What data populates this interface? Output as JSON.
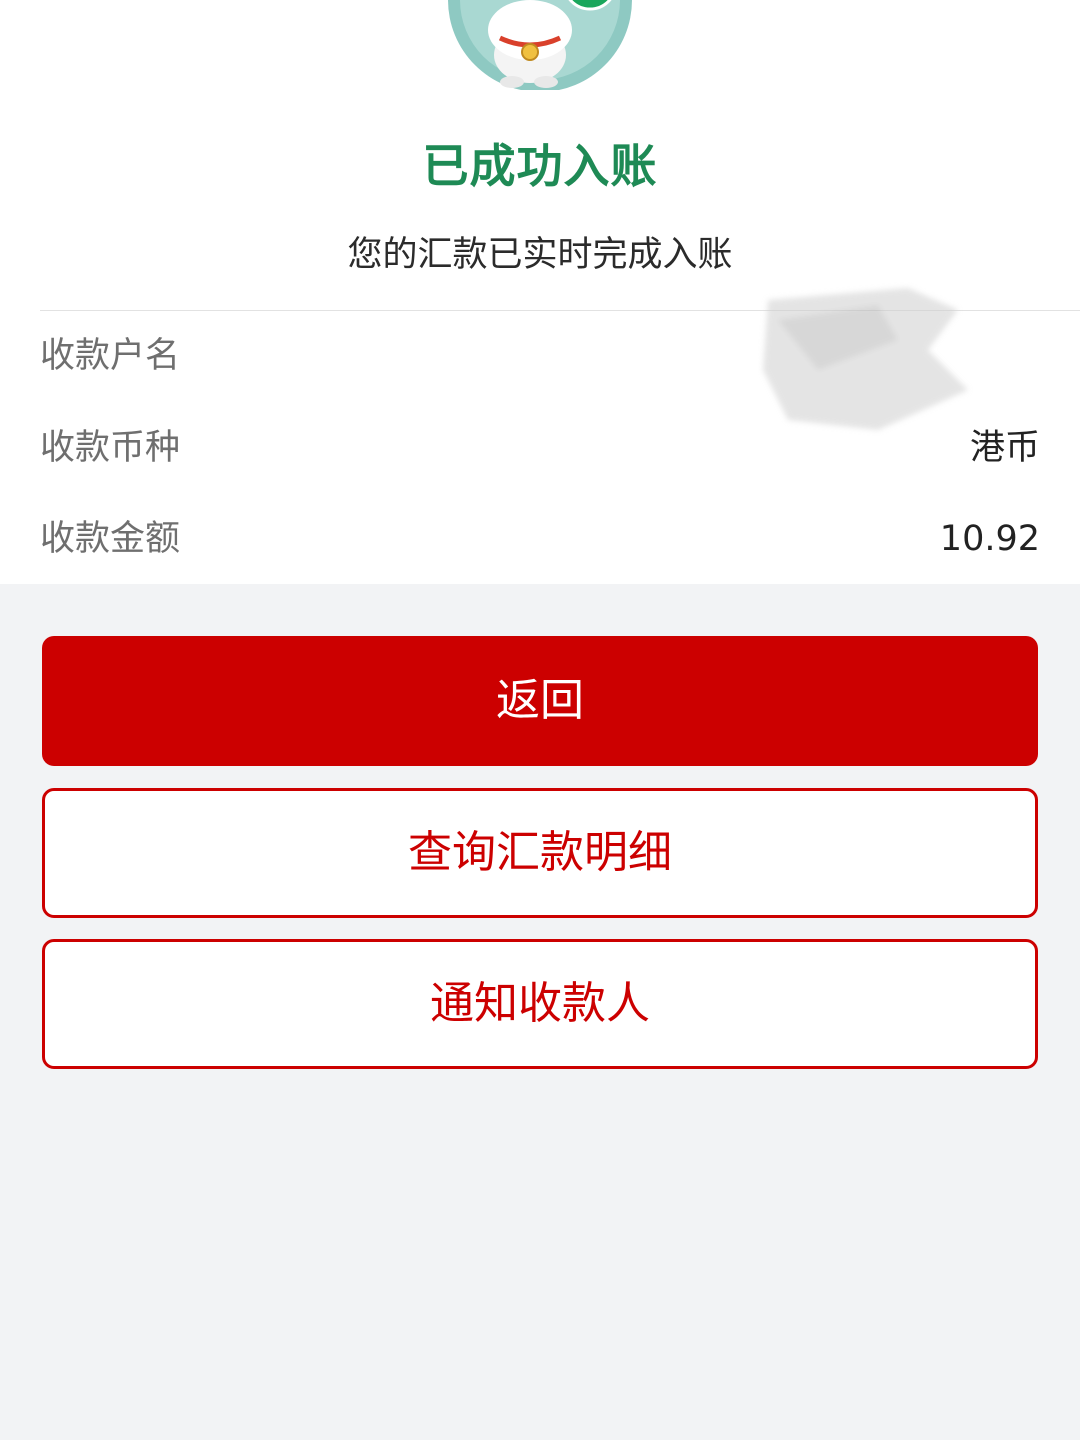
{
  "result": {
    "title": "已成功入账",
    "subtitle": "您的汇款已实时完成入账"
  },
  "details": {
    "rows": [
      {
        "label": "收款户名",
        "value": ""
      },
      {
        "label": "收款币种",
        "value": "港币"
      },
      {
        "label": "收款金额",
        "value": "10.92"
      }
    ]
  },
  "buttons": {
    "back": "返回",
    "query": "查询汇款明细",
    "notify": "通知收款人"
  },
  "colors": {
    "success_green": "#1e8a55",
    "primary_red": "#cc0000",
    "page_bg": "#f2f3f5"
  },
  "icons": {
    "mascot": "mascot-success-icon",
    "check": "check-icon"
  }
}
